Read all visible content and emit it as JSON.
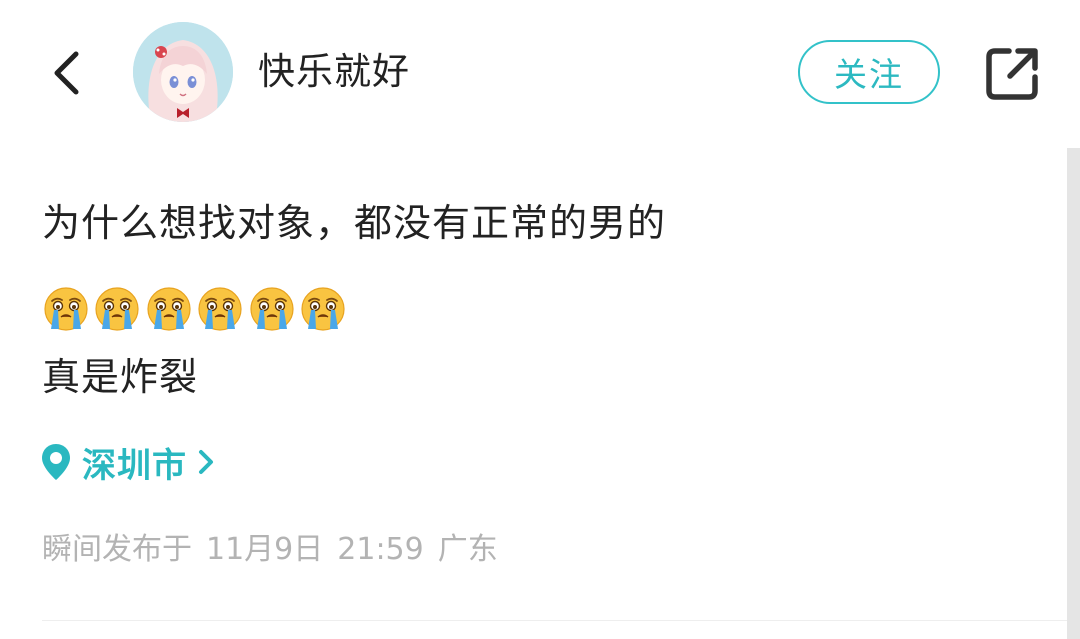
{
  "header": {
    "username": "快乐就好",
    "follow_label": "关注",
    "back_icon": "chevron-left-icon",
    "share_icon": "share-external-icon"
  },
  "post": {
    "title": "为什么想找对象，都没有正常的男的",
    "emoji_count": 6,
    "emoji_name": "loudly-crying-face",
    "text": "真是炸裂",
    "location": "深圳市",
    "meta": {
      "status": "瞬间发布于",
      "date": "11月9日",
      "time": "21:59",
      "region": "广东"
    }
  },
  "colors": {
    "accent": "#2ab8c0",
    "meta_text": "#b3b3b3",
    "text": "#222222"
  }
}
